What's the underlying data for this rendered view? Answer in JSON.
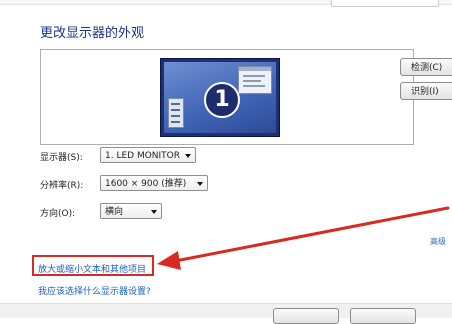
{
  "header": {
    "title": "更改显示器的外观"
  },
  "preview": {
    "monitor_number": "1"
  },
  "buttons": {
    "detect": "检测(C)",
    "identify": "识别(I)"
  },
  "settings": {
    "display_label": "显示器(S):",
    "display_value": "1. LED MONITOR",
    "resolution_label": "分辨率(R):",
    "resolution_value": "1600 × 900 (推荐)",
    "orientation_label": "方向(O):",
    "orientation_value": "横向"
  },
  "links": {
    "advanced": "高级",
    "enlarge_text": "放大或缩小文本和其他项目",
    "which_settings": "我应该选择什么显示器设置?"
  },
  "colors": {
    "annotation": "#d72b20",
    "link": "#1a5fc4",
    "title": "#1e3287"
  }
}
